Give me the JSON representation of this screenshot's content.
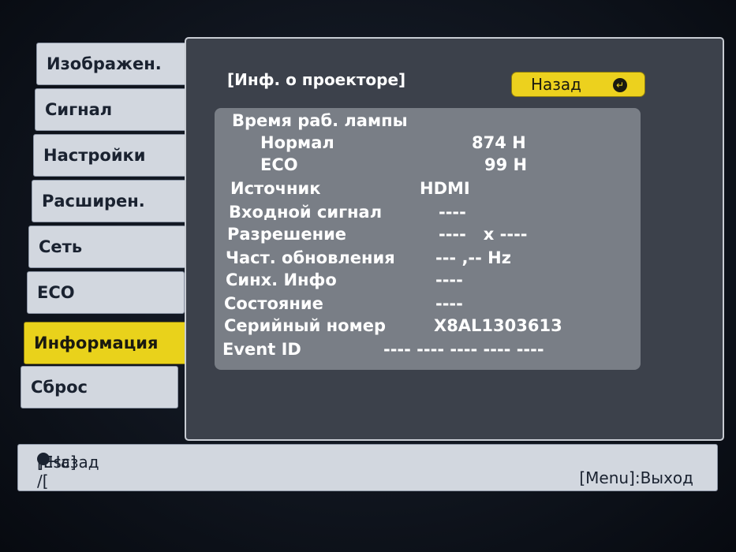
{
  "sidebar": {
    "items": [
      {
        "label": "Изображен."
      },
      {
        "label": "Сигнал"
      },
      {
        "label": "Настройки"
      },
      {
        "label": "Расширен."
      },
      {
        "label": "Сеть"
      },
      {
        "label": "ECO"
      },
      {
        "label": "Информация",
        "active": true
      },
      {
        "label": "Сброс"
      }
    ]
  },
  "panel": {
    "title": "[Инф. о проекторе]",
    "back_button": {
      "label": "Назад",
      "icon": "return-icon"
    }
  },
  "info": {
    "lamp_hours_label": "Время раб. лампы",
    "normal_label": "Нормал",
    "normal_value": "874 H",
    "eco_label": "ECO",
    "eco_value": "99 H",
    "source_label": "Источник",
    "source_value": "HDMI",
    "input_signal_label": "Входной сигнал",
    "input_signal_value": "----",
    "resolution_label": "Разрешение",
    "resolution_value": "----   x ----",
    "refresh_label": "Част. обновления",
    "refresh_value": "--- ,-- Hz",
    "sync_label": "Синх. Инфо",
    "sync_value": "----",
    "status_label": "Состояние",
    "status_value": "----",
    "serial_label": "Серийный номер",
    "serial_value": "X8AL1303613",
    "event_label": "Event ID",
    "event_value": "---- ---- ---- ---- ----"
  },
  "footer": {
    "esc_prefix": "[Esc] /[",
    "esc_suffix": "]:Назад",
    "menu_exit": "[Menu]:Выход"
  },
  "colors": {
    "active_tab": "#e9d21b",
    "tab": "#d2d7df",
    "panel": "#3c414b",
    "info_box": "#797e86"
  }
}
